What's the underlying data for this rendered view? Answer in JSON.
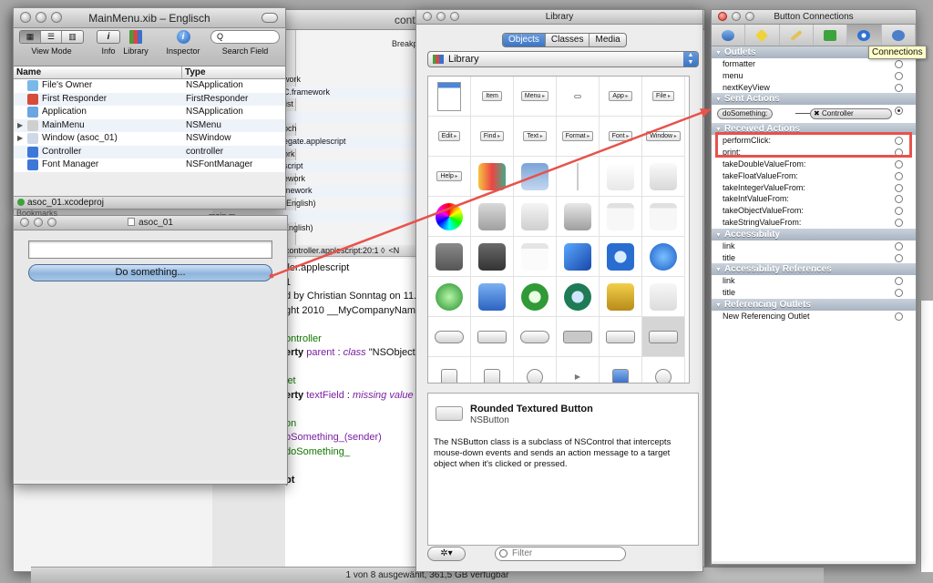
{
  "xcode": {
    "title_fragment": "cont",
    "breakpoints_fragment": "Breakp",
    "file_list_fragments": [
      "work",
      "C.framework",
      "list",
      "",
      "pch",
      "egate.applescript",
      "ork",
      "script",
      "ework",
      "mework",
      "(English)",
      "",
      "English)"
    ],
    "side_items": [
      "Bookmarks",
      "main.m"
    ],
    "path_bar": "controller.applescript:20:1 ◊",
    "code_lines": [
      {
        "parts": [
          {
            "t": "ller.applescript",
            "c": ""
          }
        ]
      },
      {
        "parts": [
          {
            "t": "1",
            "c": ""
          }
        ]
      },
      {
        "parts": [
          {
            "t": "d by Christian Sonntag on 11.",
            "c": ""
          }
        ]
      },
      {
        "parts": [
          {
            "t": "ght 2010 __MyCompanyName",
            "c": ""
          }
        ]
      },
      {
        "parts": [
          {
            "t": "",
            "c": ""
          }
        ]
      },
      {
        "parts": [
          {
            "t": "ontroller",
            "c": "str"
          }
        ]
      },
      {
        "parts": [
          {
            "t": "erty ",
            "c": "kw"
          },
          {
            "t": "parent",
            "c": "cls"
          },
          {
            "t": " : ",
            "c": ""
          },
          {
            "t": "class",
            "c": "it"
          },
          {
            "t": " \"NSObject\"",
            "c": ""
          }
        ]
      },
      {
        "parts": [
          {
            "t": "",
            "c": ""
          }
        ]
      },
      {
        "parts": [
          {
            "t": "let",
            "c": "str"
          }
        ]
      },
      {
        "parts": [
          {
            "t": "erty ",
            "c": "kw"
          },
          {
            "t": "textField",
            "c": "cls"
          },
          {
            "t": " : ",
            "c": ""
          },
          {
            "t": "missing value",
            "c": "it"
          }
        ]
      },
      {
        "parts": [
          {
            "t": "",
            "c": ""
          }
        ]
      },
      {
        "parts": [
          {
            "t": "on",
            "c": "str"
          }
        ]
      },
      {
        "parts": [
          {
            "t": "oSomething_(sender)",
            "c": "cls"
          }
        ]
      },
      {
        "parts": [
          {
            "t": "doSomething_",
            "c": "str"
          }
        ]
      },
      {
        "parts": [
          {
            "t": "",
            "c": ""
          }
        ]
      },
      {
        "parts": [
          {
            "t": "pt",
            "c": "kw"
          }
        ]
      }
    ],
    "status_text": "1 von 8 ausgewählt, 361,5 GB verfügbar"
  },
  "xib_window": {
    "title": "MainMenu.xib – Englisch",
    "toolbar": {
      "view_mode_label": "View Mode",
      "info_label": "Info",
      "info_glyph": "i",
      "library_label": "Library",
      "inspector_label": "Inspector",
      "search_label": "Search Field",
      "search_glyph": "Q"
    },
    "columns": [
      "Name",
      "Type"
    ],
    "objects": [
      {
        "name": "File's Owner",
        "type": "NSApplication",
        "color": "#7ab8e8",
        "disc": ""
      },
      {
        "name": "First Responder",
        "type": "FirstResponder",
        "color": "#d84a3a",
        "disc": ""
      },
      {
        "name": "Application",
        "type": "NSApplication",
        "color": "#6aa6e0",
        "disc": ""
      },
      {
        "name": "MainMenu",
        "type": "NSMenu",
        "color": "#cfcfcf",
        "disc": "▶"
      },
      {
        "name": "Window (asoc_01)",
        "type": "NSWindow",
        "color": "#cfd8e6",
        "disc": "▶"
      },
      {
        "name": "Controller",
        "type": "controller",
        "color": "#3d78d8",
        "disc": ""
      },
      {
        "name": "Font Manager",
        "type": "NSFontManager",
        "color": "#3d78d8",
        "disc": ""
      }
    ],
    "status": "asoc_01.xcodeproj"
  },
  "asoc_window": {
    "title": "asoc_01",
    "button_label": "Do something...",
    "field_value": "",
    "bookmarks_label": "Bookmarks"
  },
  "library": {
    "title": "Library",
    "tabs": [
      "Objects",
      "Classes",
      "Media"
    ],
    "active_tab": "Objects",
    "popup_label": "Library",
    "row1": [
      "",
      "Item",
      "Menu",
      "",
      "App",
      "File"
    ],
    "row2": [
      "Edit",
      "Find",
      "Text",
      "Format",
      "Font",
      "Window"
    ],
    "row3_first": "Help",
    "selected": {
      "title": "Rounded Textured Button",
      "class": "NSButton",
      "description": "The NSButton class is a subclass of NSControl that intercepts mouse-down events and sends an action message to a target object when it's clicked or pressed."
    },
    "gear_glyph": "✲▾",
    "filter_placeholder": "Filter"
  },
  "connections": {
    "title": "Button Connections",
    "tooltip": "Connections",
    "sections": {
      "outlets": "Outlets",
      "sent_actions": "Sent Actions",
      "received_actions": "Received Actions",
      "accessibility": "Accessibility",
      "accessibility_references": "Accessibility References",
      "referencing_outlets": "Referencing Outlets"
    },
    "outlets": [
      "formatter",
      "menu",
      "nextKeyView"
    ],
    "sent_action": {
      "name": "doSomething:",
      "target": "Controller",
      "target_glyph": "✖"
    },
    "received_actions": [
      "performClick:",
      "print:",
      "takeDoubleValueFrom:",
      "takeFloatValueFrom:",
      "takeIntegerValueFrom:",
      "takeIntValueFrom:",
      "takeObjectValueFrom:",
      "takeStringValueFrom:"
    ],
    "accessibility": [
      "link",
      "title"
    ],
    "accessibility_references": [
      "link",
      "title"
    ],
    "referencing_outlets": [
      "New Referencing Outlet"
    ],
    "accent": "#e8524a"
  }
}
